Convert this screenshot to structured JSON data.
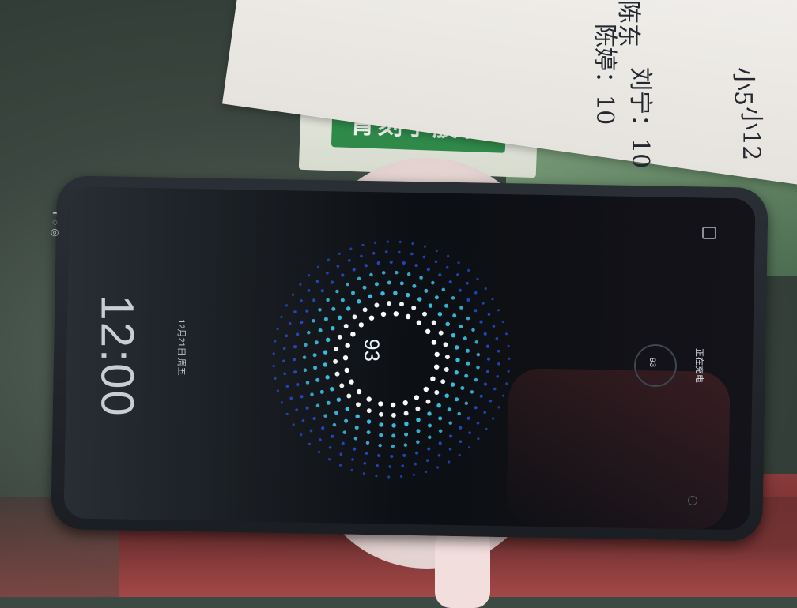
{
  "lockscreen": {
    "clock": "12:00",
    "date": "12月21日 周五",
    "battery_percent_center": "93",
    "battery_percent_ring": "93",
    "charging_status": "正在充电",
    "status_icons": "◐◌◎"
  },
  "background": {
    "box_brand_text": "青刻宁胶囊",
    "handwriting_lines": [
      "陈东",
      "陈婷：10",
      "刘宁：10",
      "小5",
      "小12"
    ]
  },
  "colors": {
    "dot_inner": "#ffffff",
    "dot_mid": "#3fd0f5",
    "dot_outer": "#2a5cff"
  },
  "icons": [
    "camera-icon",
    "fingerprint-icon"
  ]
}
